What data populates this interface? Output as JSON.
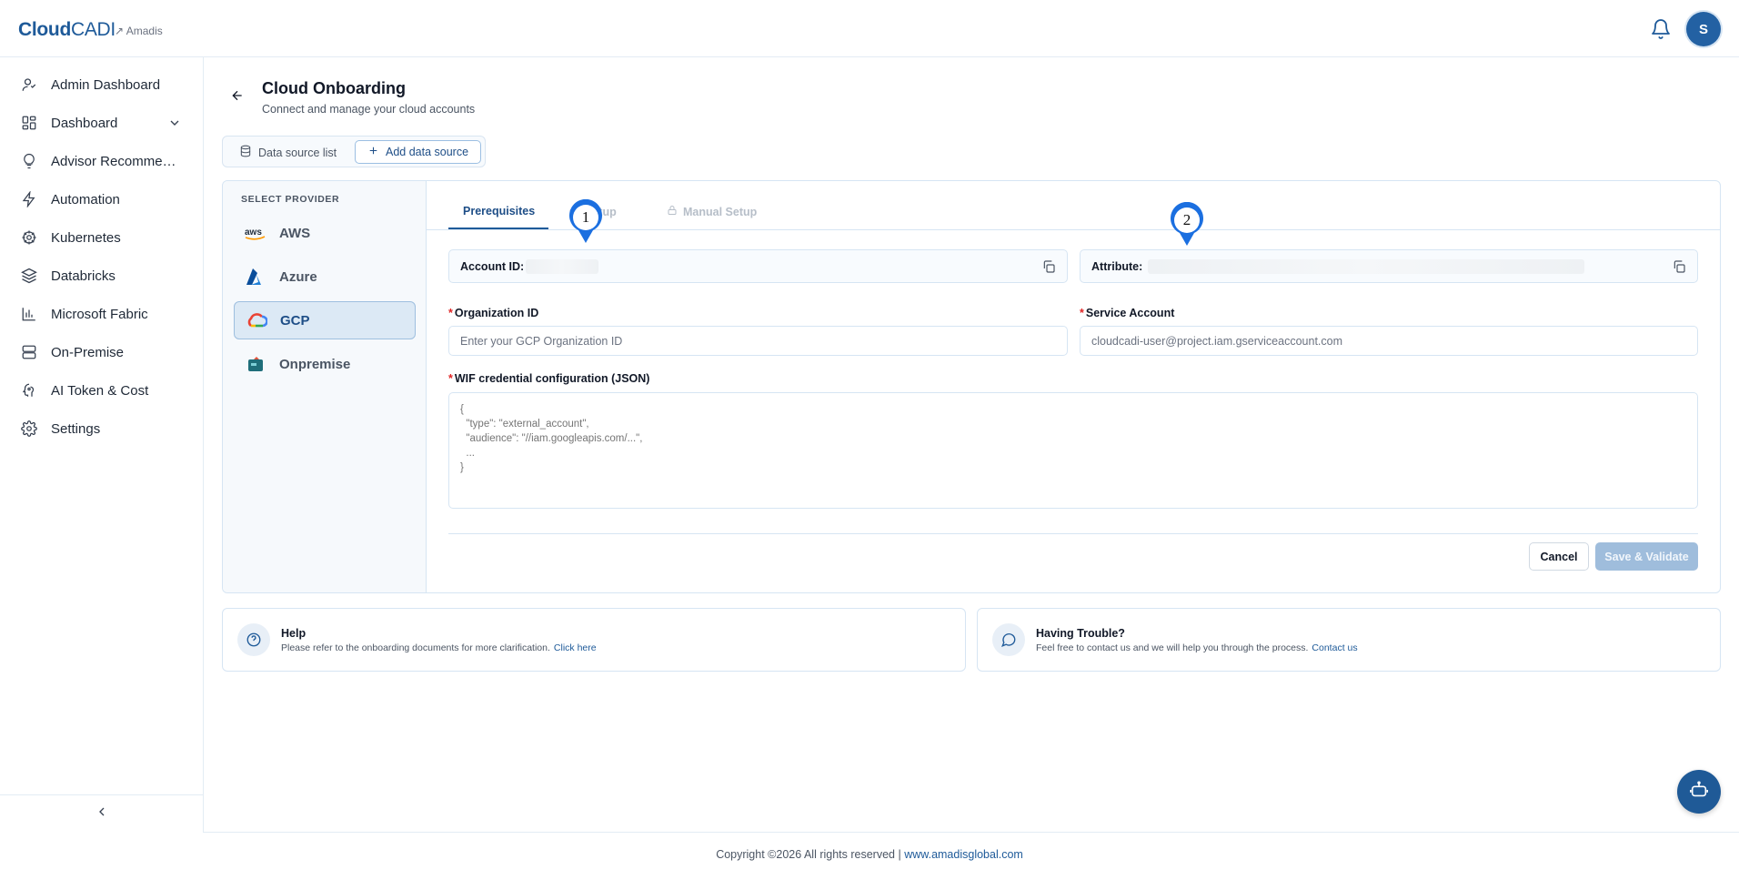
{
  "app": {
    "logo_bold": "Cloud",
    "logo_light": "CADI",
    "tenant": "↗ Amadis",
    "avatar_initial": "S"
  },
  "sidebar": {
    "items": [
      {
        "label": "Admin Dashboard",
        "icon": "user-icon"
      },
      {
        "label": "Dashboard",
        "icon": "grid-icon"
      },
      {
        "label": "Advisor Recommendations",
        "icon": "lightbulb-icon"
      },
      {
        "label": "Automation",
        "icon": "bolt-icon"
      },
      {
        "label": "Kubernetes",
        "icon": "helm-icon"
      },
      {
        "label": "Databricks",
        "icon": "layers-icon"
      },
      {
        "label": "Microsoft Fabric",
        "icon": "bar-chart-icon"
      },
      {
        "label": "On-Premise",
        "icon": "server-icon"
      },
      {
        "label": "AI Token & Cost",
        "icon": "ai-icon"
      },
      {
        "label": "Settings",
        "icon": "gear-icon"
      }
    ]
  },
  "page": {
    "title": "Cloud Onboarding",
    "subtitle": "Connect and manage your cloud accounts",
    "ds_list_label": "Data source list",
    "ds_add_label": "Add data source"
  },
  "providers": {
    "heading": "SELECT PROVIDER",
    "items": [
      {
        "label": "AWS",
        "active": false
      },
      {
        "label": "Azure",
        "active": false
      },
      {
        "label": "GCP",
        "active": true
      },
      {
        "label": "Onpremise",
        "active": false
      }
    ]
  },
  "tabs": [
    {
      "label": "Prerequisites",
      "state": "active"
    },
    {
      "label": "Setup",
      "state": "disabled"
    },
    {
      "label": "Manual Setup",
      "state": "disabled"
    }
  ],
  "form": {
    "account_id_label": "Account ID:",
    "attribute_label": "Attribute:",
    "org_id_label": "Organization ID",
    "org_id_placeholder": "Enter your GCP Organization ID",
    "service_account_label": "Service Account",
    "service_account_placeholder": "cloudcadi-user@project.iam.gserviceaccount.com",
    "wif_label": "WIF credential configuration (JSON)",
    "wif_placeholder": "{\n  \"type\": \"external_account\",\n  \"audience\": \"//iam.googleapis.com/...\",\n  ...\n}",
    "cancel_label": "Cancel",
    "save_label": "Save & Validate"
  },
  "markers": [
    "1",
    "2"
  ],
  "help": {
    "help_title": "Help",
    "help_text": "Please refer to the onboarding documents for more clarification.",
    "help_link": "Click here",
    "trouble_title": "Having Trouble?",
    "trouble_text": "Feel free to contact us and we will help you through the process.",
    "trouble_link": "Contact us"
  },
  "footer": {
    "text": "Copyright ©2026 All rights reserved |",
    "link": "www.amadisglobal.com"
  },
  "colors": {
    "brand": "#1e5a99",
    "accent_bg": "#dce9f5",
    "marker": "#1b6fe0"
  }
}
